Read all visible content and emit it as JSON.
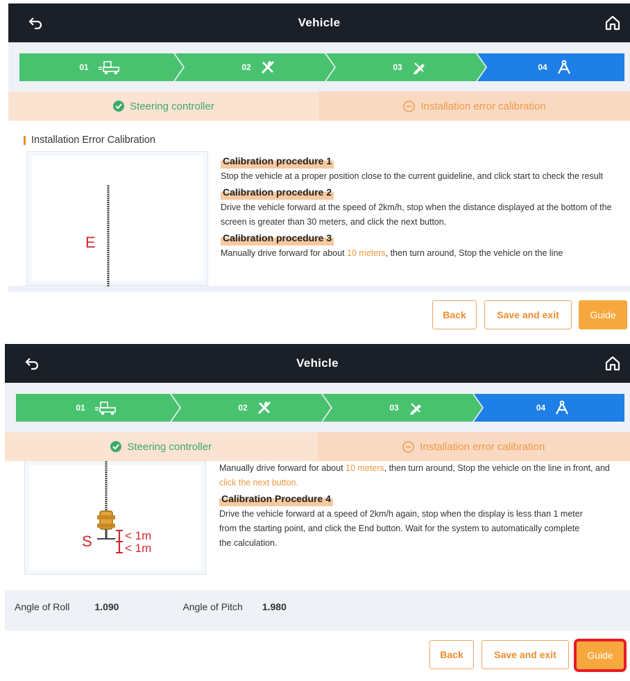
{
  "header": {
    "title": "Vehicle",
    "back_icon": "back-arrow-icon",
    "home_icon": "home-icon"
  },
  "steps": [
    {
      "num": "01",
      "icon": "vehicle-icon",
      "state": "done"
    },
    {
      "num": "02",
      "icon": "tools-icon",
      "state": "done"
    },
    {
      "num": "03",
      "icon": "calibrate-pencil-icon",
      "state": "done"
    },
    {
      "num": "04",
      "icon": "compass-icon",
      "state": "active"
    }
  ],
  "tabs": {
    "steering": "Steering controller",
    "calibration": "Installation error calibration"
  },
  "section_title": "Installation Error Calibration",
  "procedures": {
    "p1_title": "Calibration procedure 1",
    "p1_text": "Stop the vehicle at a proper position close to the current guideline, and click start to check the result",
    "p2_title": "Calibration procedure 2",
    "p2_text": "Drive the vehicle forward at the speed of 2km/h, stop when the distance displayed at the bottom of the screen is greater than 30 meters, and click the next button.",
    "p3_title": "Calibration procedure 3",
    "p3_text_a": "Manually drive forward for about ",
    "p3_text_hl": "10 meters",
    "p3_text_b": ", then turn around, Stop the vehicle on the line in front, and ",
    "p3_text_hl2": "click the next button.",
    "p3_text_b_short": ", then turn around, Stop the vehicle on the line",
    "p4_title": "Calibration Procedure 4",
    "p4_text": "Drive the vehicle forward at a speed of 2km/h again, stop when the display is less than 1 meter from the starting point, and click the End button. Wait for the system to automatically complete the calculation."
  },
  "diagram": {
    "end_label": "E",
    "start_label": "S",
    "dist_label_1": "< 1m",
    "dist_label_2": "< 1m"
  },
  "angles": {
    "roll_label": "Angle of Roll",
    "roll_value": "1.090",
    "pitch_label": "Angle of Pitch",
    "pitch_value": "1.980"
  },
  "buttons": {
    "back": "Back",
    "save_exit": "Save and exit",
    "guide": "Guide"
  },
  "colors": {
    "step_done": "#48c26f",
    "step_active": "#1e7fe6",
    "accent": "#f6a83e",
    "highlight": "#e81c25"
  }
}
